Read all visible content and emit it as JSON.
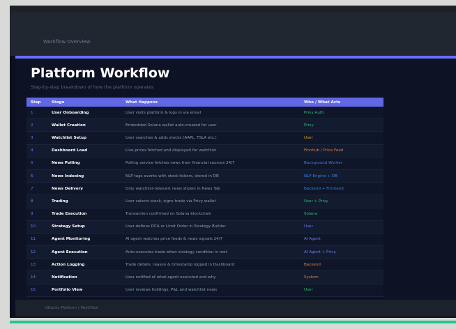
{
  "topbar": {
    "title": "Workflow Overview"
  },
  "page": {
    "title": "Platform Workflow",
    "subtitle": "Step-by-step breakdown of how the platform operates"
  },
  "table": {
    "headers": [
      "Step",
      "Stage",
      "What Happens",
      "Who / What Acts"
    ],
    "rows": [
      {
        "num": "1",
        "stage": "User Onboarding",
        "what": "User visits platform & logs in via email",
        "who": "Privy Auth",
        "color": "#2fbf71"
      },
      {
        "num": "2",
        "stage": "Wallet Creation",
        "what": "Embedded Solana wallet auto-created for user",
        "who": "Privy",
        "color": "#2fbf71"
      },
      {
        "num": "3",
        "stage": "Watchlist Setup",
        "what": "User searches & adds stocks (AAPL, TSLA etc.)",
        "who": "User",
        "color": "#e0a020"
      },
      {
        "num": "4",
        "stage": "Dashboard Load",
        "what": "Live prices fetched and displayed for watchlist",
        "who": "Finnhub / Price Feed",
        "color": "#e07c3c"
      },
      {
        "num": "5",
        "stage": "News Polling",
        "what": "Polling service fetches news from financial sources 24/7",
        "who": "Background Worker",
        "color": "#3d7fd9"
      },
      {
        "num": "6",
        "stage": "News Indexing",
        "what": "NLP tags events with stock tickers, stored in DB",
        "who": "NLP Engine + DB",
        "color": "#3d7fd9"
      },
      {
        "num": "7",
        "stage": "News Delivery",
        "what": "Only watchlist-relevant news shown in News Tab",
        "who": "Backend + Frontend",
        "color": "#3d7fd9"
      },
      {
        "num": "8",
        "stage": "Trading",
        "what": "User selects stock, signs trade via Privy wallet",
        "who": "User + Privy",
        "color": "#2fbf71"
      },
      {
        "num": "9",
        "stage": "Trade Execution",
        "what": "Transaction confirmed on Solana blockchain",
        "who": "Solana",
        "color": "#2fbf71"
      },
      {
        "num": "10",
        "stage": "Strategy Setup",
        "what": "User defines DCA or Limit Order in Strategy Builder",
        "who": "User",
        "color": "#6e79f0"
      },
      {
        "num": "11",
        "stage": "Agent Monitoring",
        "what": "AI agent watches price feeds & news signals 24/7",
        "who": "AI Agent",
        "color": "#6e79f0"
      },
      {
        "num": "12",
        "stage": "Agent Execution",
        "what": "Auto-executes trade when strategy condition is met",
        "who": "AI Agent + Privy",
        "color": "#6e79f0"
      },
      {
        "num": "13",
        "stage": "Action Logging",
        "what": "Trade details, reason & timestamp logged in Dashboard",
        "who": "Backend",
        "color": "#e07c3c"
      },
      {
        "num": "14",
        "stage": "Notification",
        "what": "User notified of what agent executed and why",
        "who": "System",
        "color": "#e07c3c"
      },
      {
        "num": "15",
        "stage": "Portfolio View",
        "what": "User reviews holdings, P&L and watchlist news",
        "who": "User",
        "color": "#2fbf71"
      }
    ]
  },
  "footer": {
    "text": "xStocks Platform  |  Workflow"
  },
  "colors": {
    "accent": "#6c6ef5",
    "green": "#1ec98a",
    "background": "#0b1020"
  }
}
